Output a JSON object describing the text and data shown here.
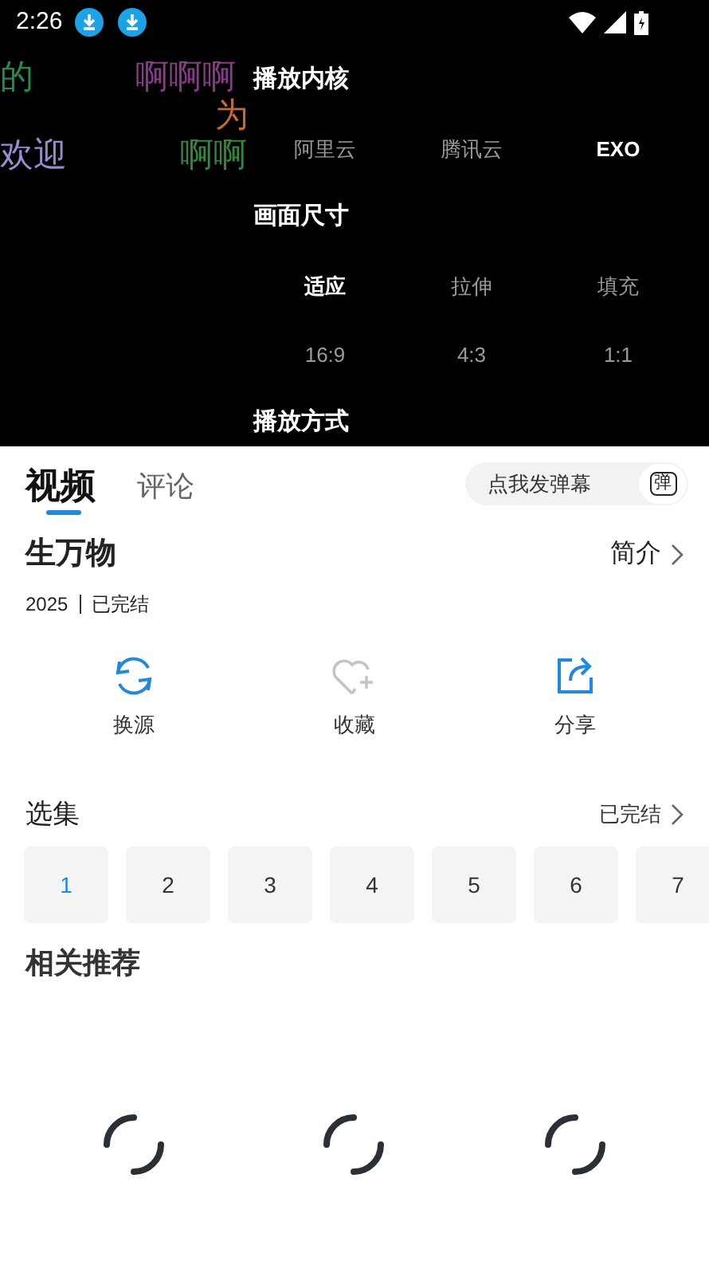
{
  "status_bar": {
    "time": "2:26"
  },
  "danmaku": [
    {
      "text": "的",
      "color": "#1e8f4a"
    },
    {
      "text": "啊啊啊",
      "color": "#8a3a8a"
    },
    {
      "text": "为",
      "color": "#c8692e"
    },
    {
      "text": "欢迎",
      "color": "#9a8ad0"
    },
    {
      "text": "啊啊",
      "color": "#2f8a3a"
    }
  ],
  "player_settings": [
    {
      "title": "播放内核",
      "rows": [
        [
          {
            "label": "阿里云",
            "selected": false
          },
          {
            "label": "腾讯云",
            "selected": false
          },
          {
            "label": "EXO",
            "selected": true
          }
        ]
      ]
    },
    {
      "title": "画面尺寸",
      "rows": [
        [
          {
            "label": "适应",
            "selected": true
          },
          {
            "label": "拉伸",
            "selected": false
          },
          {
            "label": "填充",
            "selected": false
          }
        ],
        [
          {
            "label": "16:9",
            "selected": false
          },
          {
            "label": "4:3",
            "selected": false
          },
          {
            "label": "1:1",
            "selected": false
          }
        ]
      ]
    },
    {
      "title": "播放方式"
    }
  ],
  "tabs": [
    {
      "label": "视频",
      "selected": true
    },
    {
      "label": "评论",
      "selected": false
    }
  ],
  "danmaku_input": {
    "placeholder": "点我发弹幕",
    "icon_label": "弹"
  },
  "title": "生万物",
  "intro_link": "简介",
  "meta": {
    "year": "2025",
    "status": "已完结"
  },
  "actions": [
    {
      "kind": "switch_source",
      "label": "换源",
      "active": true
    },
    {
      "kind": "favorite",
      "label": "收藏",
      "active": false
    },
    {
      "kind": "share",
      "label": "分享",
      "active": true
    }
  ],
  "episodes": {
    "title": "选集",
    "status_link": "已完结",
    "items": [
      {
        "label": "1",
        "selected": true
      },
      {
        "label": "2",
        "selected": false
      },
      {
        "label": "3",
        "selected": false
      },
      {
        "label": "4",
        "selected": false
      },
      {
        "label": "5",
        "selected": false
      },
      {
        "label": "6",
        "selected": false
      },
      {
        "label": "7",
        "selected": false
      }
    ]
  },
  "related": {
    "title": "相关推荐",
    "loading": true
  }
}
